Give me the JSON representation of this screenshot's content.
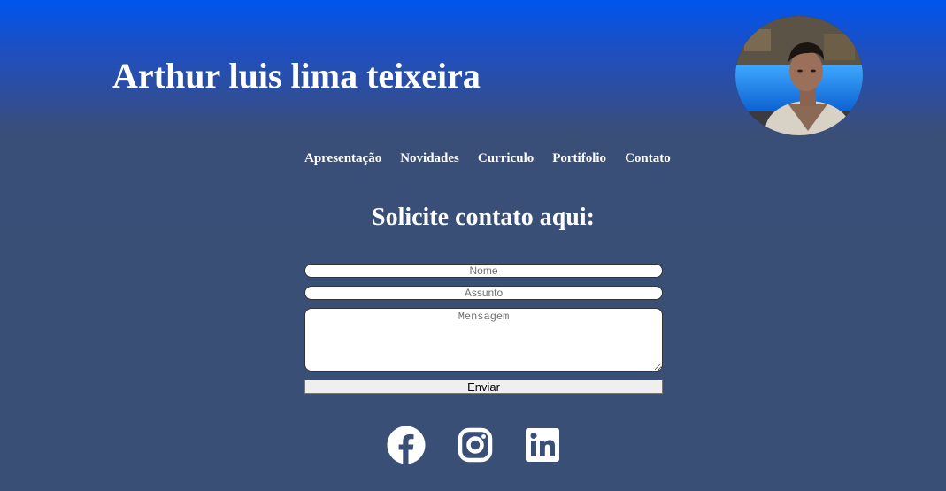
{
  "header": {
    "title": "Arthur luis lima teixeira",
    "avatar_icon": "profile-photo"
  },
  "nav": {
    "items": [
      {
        "label": "Apresentação"
      },
      {
        "label": "Novidades"
      },
      {
        "label": "Curriculo"
      },
      {
        "label": "Portifolio"
      },
      {
        "label": "Contato"
      }
    ]
  },
  "contact": {
    "heading": "Solicite contato aqui:",
    "name_placeholder": "Nome",
    "subject_placeholder": "Assunto",
    "message_placeholder": "Mensagem",
    "submit_label": "Enviar"
  },
  "social": {
    "icons": [
      "facebook-icon",
      "instagram-icon",
      "linkedin-icon"
    ]
  },
  "colors": {
    "gradient_top": "#0055ee",
    "background": "#3a4f76",
    "text": "#ffffff"
  }
}
